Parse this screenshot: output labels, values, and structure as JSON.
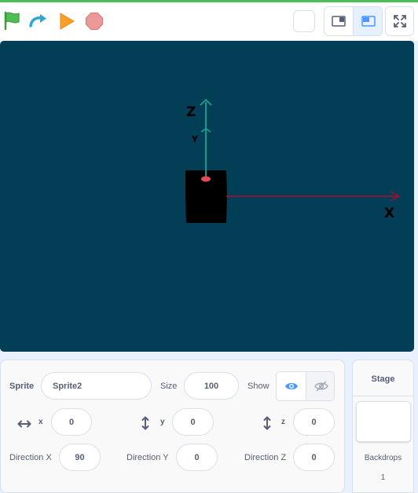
{
  "toolbar": {
    "icons": [
      "green-flag-icon",
      "redo-icon",
      "play-icon",
      "stop-icon",
      "small-stage-icon",
      "large-stage-icon",
      "fullscreen-icon"
    ]
  },
  "stage": {
    "axis_x_label": "X",
    "axis_y_label": "Y",
    "axis_z_label": "Z",
    "colors": {
      "background": "#023e55",
      "x_axis": "#8b1538",
      "yz_axis": "#1aa595",
      "object": "#000000"
    }
  },
  "sprite_panel": {
    "sprite_label": "Sprite",
    "sprite_name": "Sprite2",
    "size_label": "Size",
    "size_value": "100",
    "show_label": "Show",
    "x_label": "x",
    "x_value": "0",
    "y_label": "y",
    "y_value": "0",
    "z_label": "z",
    "z_value": "0",
    "direction_x_label": "Direction X",
    "direction_x_value": "90",
    "direction_y_label": "Direction Y",
    "direction_y_value": "0",
    "direction_z_label": "Direction Z",
    "direction_z_value": "0"
  },
  "stage_panel": {
    "title": "Stage",
    "backdrops_label": "Backdrops",
    "backdrops_count": "1"
  }
}
